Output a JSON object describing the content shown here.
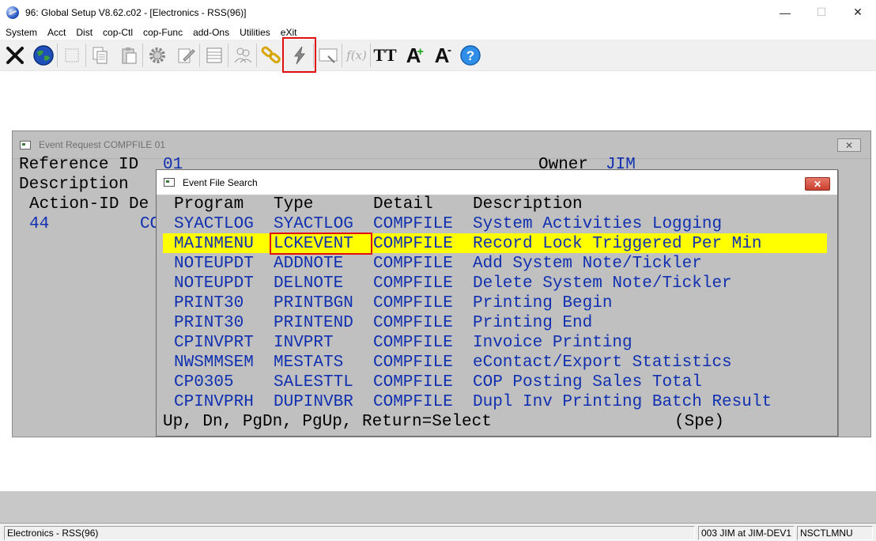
{
  "window": {
    "title": "96: Global Setup V8.62.c02 - [Electronics - RSS(96)]"
  },
  "menu": [
    "System",
    "Acct",
    "Dist",
    "cop-Ctl",
    "cop-Func",
    "add-Ons",
    "Utilities",
    "eXit"
  ],
  "toolbar": {
    "icons": [
      "close-x-icon",
      "globe-icon",
      "blank-icon",
      "copy-icon",
      "paste-icon",
      "gear-icon",
      "edit-icon",
      "table-icon",
      "people-icon",
      "link-icon",
      "lightning-icon",
      "screen-icon",
      "function-icon",
      "font-icon",
      "font-increase-icon",
      "font-decrease-icon",
      "help-icon"
    ],
    "function_label": "f(x)",
    "font_label": "TT",
    "font_increase_label": "A",
    "font_decrease_label": "A"
  },
  "event_request": {
    "title": "Event Request COMPFILE 01",
    "reference_label": "Reference ID",
    "reference_value": "01",
    "owner_label": "Owner",
    "owner_value": "JIM",
    "description_label": "Description",
    "action_label": "Action-ID De",
    "action_id": "44",
    "action_partial": "CO"
  },
  "search": {
    "title": "Event File Search",
    "headers": {
      "program": "Program",
      "type": "Type",
      "detail": "Detail",
      "description": "Description"
    },
    "rows": [
      {
        "program": "SYACTLOG",
        "type": "SYACTLOG",
        "detail": "COMPFILE",
        "description": "System Activities Logging"
      },
      {
        "program": "MAINMENU",
        "type": "LCKEVENT",
        "detail": "COMPFILE",
        "description": "Record Lock Triggered Per Min"
      },
      {
        "program": "NOTEUPDT",
        "type": "ADDNOTE",
        "detail": "COMPFILE",
        "description": "Add System Note/Tickler"
      },
      {
        "program": "NOTEUPDT",
        "type": "DELNOTE",
        "detail": "COMPFILE",
        "description": "Delete System Note/Tickler"
      },
      {
        "program": "PRINT30",
        "type": "PRINTBGN",
        "detail": "COMPFILE",
        "description": "Printing Begin"
      },
      {
        "program": "PRINT30",
        "type": "PRINTEND",
        "detail": "COMPFILE",
        "description": "Printing End"
      },
      {
        "program": "CPINVPRT",
        "type": "INVPRT",
        "detail": "COMPFILE",
        "description": "Invoice Printing"
      },
      {
        "program": "NWSMMSEM",
        "type": "MESTATS",
        "detail": "COMPFILE",
        "description": "eContact/Export Statistics"
      },
      {
        "program": "CP0305",
        "type": "SALESTTL",
        "detail": "COMPFILE",
        "description": "COP Posting Sales Total"
      },
      {
        "program": "CPINVPRH",
        "type": "DUPINVBR",
        "detail": "COMPFILE",
        "description": "Dupl Inv Printing Batch Result"
      }
    ],
    "footer": "Up, Dn, PgDn, PgUp, Return=Select",
    "footer_right": "(Spe)"
  },
  "status": {
    "left": "Electronics - RSS(96)",
    "user": "003 JIM at JIM-DEV1",
    "program": "NSCTLMNU"
  },
  "colors": {
    "highlight": "#ffff00",
    "text_blue": "#1030b0",
    "callout_red": "#e01010"
  }
}
